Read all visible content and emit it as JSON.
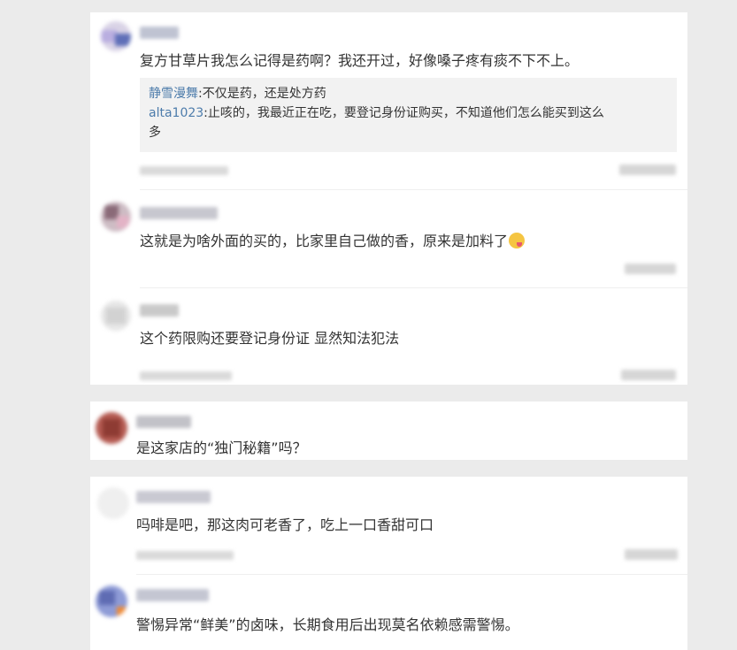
{
  "colors": {
    "page_bg": "#ebebeb",
    "card_bg": "#ffffff",
    "quote_bg": "#f2f2f2",
    "reply_name": "#4d7cab"
  },
  "thread_1": {
    "c1": {
      "text": "复方甘草片我怎么记得是药啊？我还开过，好像嗓子疼有痰不下不上。",
      "replies": [
        {
          "name": "静雪漫舞",
          "sep": ":",
          "text": "不仅是药，还是处方药"
        },
        {
          "name": "alta1023",
          "sep": ":",
          "text": "止咳的，我最近正在吃，要登记身份证购买，不知道他们怎么能买到这么"
        },
        {
          "text": "多"
        }
      ]
    },
    "c2": {
      "text": "这就是为啥外面的买的，比家里自己做的香，原来是加料了",
      "emoji": "drooling-face-emoji"
    },
    "c3": {
      "text": "这个药限购还要登记身份证 显然知法犯法"
    }
  },
  "thread_2": {
    "c1": {
      "text": "是这家店的“独门秘籍”吗？"
    }
  },
  "thread_3": {
    "c1": {
      "text": "吗啡是吧，那这肉可老香了，吃上一口香甜可口"
    },
    "c2": {
      "text": "警惕异常“鲜美”的卤味，长期食用后出现莫名依赖感需警惕。"
    }
  }
}
